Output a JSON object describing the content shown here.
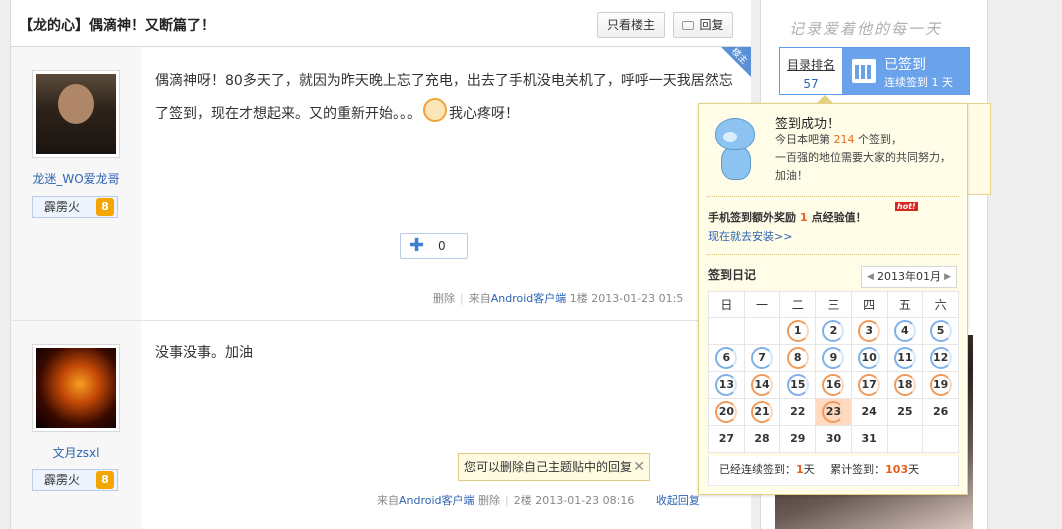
{
  "thread": {
    "title": "【龙的心】偶滴神！又断篇了！",
    "only_author": "只看楼主",
    "reply": "回复"
  },
  "posts": [
    {
      "username": "龙迷_WO爱龙哥",
      "level_name": "霹雳火",
      "level": "8",
      "badge": "楼主",
      "text_line1": "偶滴神呀！80多天了，就因为昨天晚上忘了充电，出去了手机没电关机了，呼呼一天我居然忘",
      "text_line2": "了签到，现在才想起来。又的重新开始。。。",
      "text_tail": "我心疼呀！",
      "like_count": "0",
      "delete": "删除",
      "from_prefix": "来自",
      "from_client": "Android客户端",
      "floor": "1楼",
      "time": "2013-01-23 01:5"
    },
    {
      "username": "文月zsxl",
      "level_name": "霹雳火",
      "level": "8",
      "text": "没事没事。加油",
      "from_prefix": "来自",
      "from_client": "Android客户端",
      "delete": "删除",
      "floor": "2楼",
      "time": "2013-01-23 08:16",
      "collapse": "收起回复"
    }
  ],
  "tip": {
    "text": "您可以删除自己主题贴中的回复"
  },
  "sidebar": {
    "slogan": "记录爱着他的每一天",
    "rank_label": "目录排名",
    "rank_value": "57",
    "signed_title": "已签到",
    "signed_sub": "连续签到 1 天"
  },
  "popup": {
    "title": "签到成功！",
    "line1_pre": "今日本吧第",
    "line1_num": "214",
    "line1_post": "个签到，",
    "line2": "一百强的地位需要大家的共同努力，",
    "line3": "加油！",
    "bonus_pre": "手机签到额外奖励",
    "bonus_num": "1",
    "bonus_post": "点经验值！",
    "hot": "hot!",
    "install": "现在就去安装>>",
    "diary_title": "签到日记",
    "month": "2013年01月",
    "weekdays": [
      "日",
      "一",
      "二",
      "三",
      "四",
      "五",
      "六"
    ],
    "cont_pre": "已经连续签到：",
    "cont_num": "1",
    "cont_unit": "天",
    "total_pre": "累计签到：",
    "total_num": "103",
    "total_unit": "天"
  },
  "calendar": {
    "weeks": [
      [
        {
          "d": ""
        },
        {
          "d": ""
        },
        {
          "d": "1",
          "s": "o"
        },
        {
          "d": "2",
          "s": "b"
        },
        {
          "d": "3",
          "s": "o"
        },
        {
          "d": "4",
          "s": "b"
        },
        {
          "d": "5",
          "s": "b"
        }
      ],
      [
        {
          "d": "6",
          "s": "b"
        },
        {
          "d": "7",
          "s": "b"
        },
        {
          "d": "8",
          "s": "o"
        },
        {
          "d": "9",
          "s": "b"
        },
        {
          "d": "10",
          "s": "b"
        },
        {
          "d": "11",
          "s": "b"
        },
        {
          "d": "12",
          "s": "b"
        }
      ],
      [
        {
          "d": "13",
          "s": "b"
        },
        {
          "d": "14",
          "s": "o"
        },
        {
          "d": "15",
          "s": "b"
        },
        {
          "d": "16",
          "s": "o"
        },
        {
          "d": "17",
          "s": "o"
        },
        {
          "d": "18",
          "s": "o"
        },
        {
          "d": "19",
          "s": "o"
        }
      ],
      [
        {
          "d": "20",
          "s": "o"
        },
        {
          "d": "21",
          "s": "o"
        },
        {
          "d": "22"
        },
        {
          "d": "23",
          "s": "o",
          "sel": true
        },
        {
          "d": "24"
        },
        {
          "d": "25"
        },
        {
          "d": "26"
        }
      ],
      [
        {
          "d": "27"
        },
        {
          "d": "28"
        },
        {
          "d": "29"
        },
        {
          "d": "30"
        },
        {
          "d": "31"
        },
        {
          "d": ""
        },
        {
          "d": ""
        }
      ]
    ]
  },
  "colors": {
    "accent": "#6aa3ec",
    "link": "#2d64b3",
    "highlight": "#e85c1c"
  }
}
